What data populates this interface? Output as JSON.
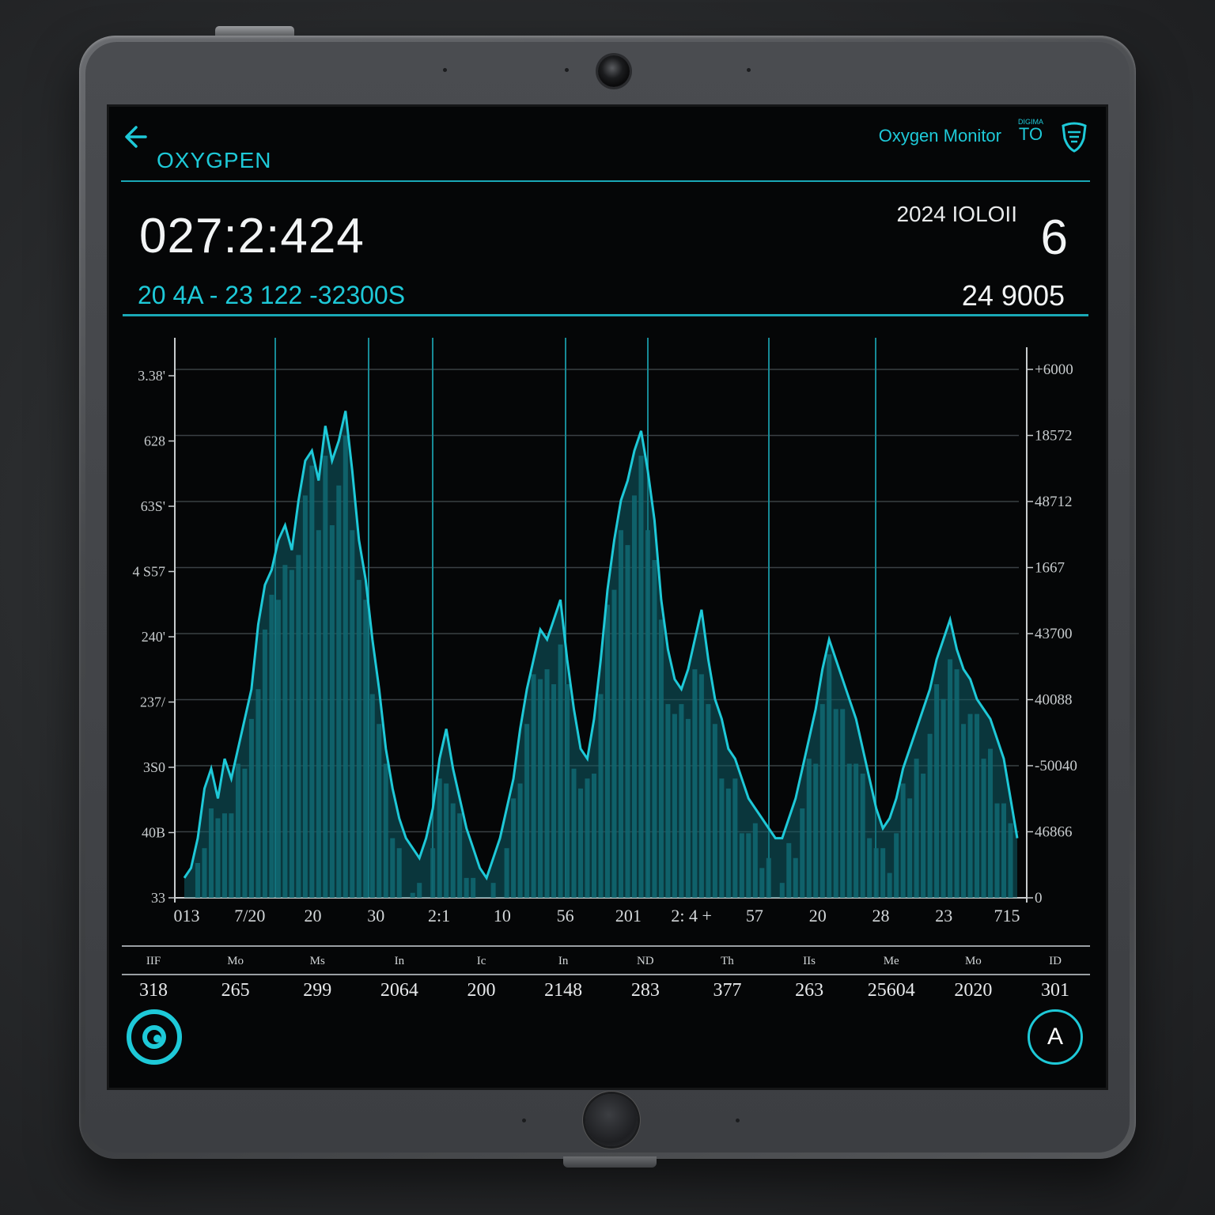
{
  "header": {
    "back_icon": "arrow-left-icon",
    "app_title": "OXYGPEN",
    "monitor_title": "Oxygen Monitor",
    "to_small": "DIGIMA",
    "to_label": "TO",
    "shield_icon": "shield-icon"
  },
  "status": {
    "time_main": "027:2:424",
    "time_sub": "20 4A  - 23 122 -32300S",
    "date_right": "2024 IOLOII",
    "big_number": "6",
    "value_right": "24 9005"
  },
  "colors": {
    "accent": "#1ec9d8",
    "background": "#050607",
    "text": "#f2f4f5"
  },
  "chart_data": {
    "type": "area",
    "y_left_ticks": [
      "3.38'",
      "628",
      "63S'",
      "4 S57",
      "240'",
      "237/",
      "3S0",
      "40B",
      "33"
    ],
    "y_right_ticks": [
      "+6000",
      "18572",
      "48712",
      "1667",
      "43700",
      "40088",
      "-50040",
      "46866",
      "0"
    ],
    "x_ticks": [
      "013",
      "7/20",
      "20",
      "30",
      "2:1",
      "10",
      "56",
      "201",
      "2: 4 +",
      "57",
      "20",
      "28",
      "23",
      "715"
    ],
    "ylim": [
      0,
      100
    ],
    "series": [
      {
        "values": [
          4,
          6,
          12,
          22,
          26,
          20,
          28,
          24,
          30,
          36,
          42,
          55,
          63,
          66,
          72,
          75,
          70,
          80,
          88,
          90,
          84,
          95,
          88,
          92,
          98,
          86,
          72,
          64,
          52,
          42,
          30,
          22,
          16,
          12,
          10,
          8,
          12,
          18,
          28,
          34,
          26,
          20,
          14,
          10,
          6,
          4,
          8,
          12,
          18,
          24,
          34,
          42,
          48,
          54,
          52,
          56,
          60,
          48,
          38,
          30,
          28,
          36,
          48,
          62,
          72,
          80,
          84,
          90,
          94,
          86,
          76,
          60,
          50,
          44,
          42,
          46,
          52,
          58,
          48,
          40,
          36,
          30,
          28,
          24,
          20,
          18,
          16,
          14,
          12,
          12,
          16,
          20,
          26,
          32,
          38,
          46,
          52,
          48,
          44,
          40,
          36,
          30,
          24,
          18,
          14,
          16,
          20,
          26,
          30,
          34,
          38,
          42,
          48,
          52,
          56,
          50,
          46,
          44,
          40,
          38,
          36,
          32,
          28,
          20,
          12
        ]
      }
    ]
  },
  "table": {
    "headers": [
      "IIF",
      "Mo",
      "Ms",
      "In",
      "Ic",
      "In",
      "ND",
      "Th",
      "IIs",
      "Me",
      "Mo",
      "ID"
    ],
    "values": [
      "318",
      "265",
      "299",
      "2064",
      "200",
      "2148",
      "283",
      "377",
      "263",
      "25604",
      "2020",
      "301"
    ]
  },
  "buttons": {
    "left_icon": "target-eye-icon",
    "right_label": "A",
    "right_icon": "alert-triangle-icon"
  }
}
